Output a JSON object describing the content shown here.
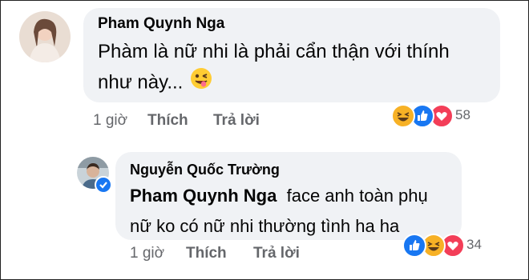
{
  "comment1": {
    "author": "Pham Quynh Nga",
    "text_line1": "Phàm là nữ nhi là phải cẩn thận với thính",
    "text_line2": "như này...",
    "emoji": "winking-tongue-emoji",
    "time": "1 giờ",
    "like_label": "Thích",
    "reply_label": "Trả lời",
    "reaction_count": "58",
    "reactions": [
      "haha",
      "like",
      "love"
    ]
  },
  "comment2": {
    "author": "Nguyễn Quốc Trường",
    "mention": "Pham Quynh Nga",
    "text_line1": "face anh toàn phụ",
    "text_line2": "nữ ko có nữ nhi thường tình ha ha",
    "verified": true,
    "time": "1 giờ",
    "like_label": "Thích",
    "reply_label": "Trả lời",
    "reaction_count": "34",
    "reactions": [
      "like",
      "haha",
      "love"
    ]
  },
  "colors": {
    "bubble": "#f0f2f5",
    "secondary_text": "#65676b",
    "like_blue": "#1877f2",
    "love_red": "#f33e58",
    "haha_yellow": "#f7b125"
  }
}
